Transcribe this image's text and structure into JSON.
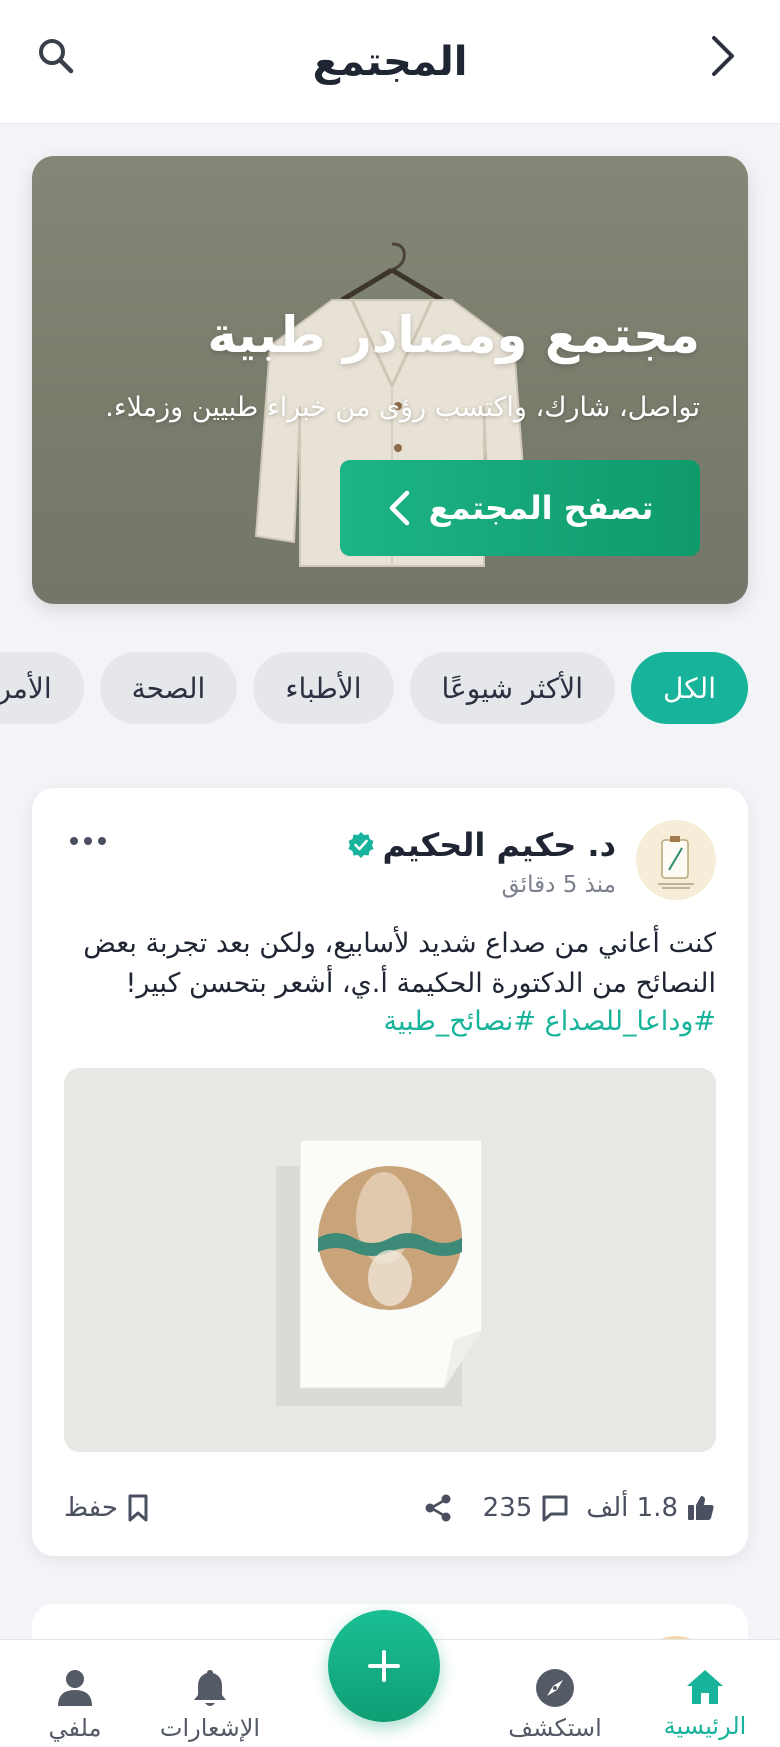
{
  "header": {
    "title": "المجتمع",
    "back_icon": "chevron-back-icon",
    "search_icon": "search-icon"
  },
  "hero": {
    "title": "مجتمع ومصادر طبية",
    "subtitle": "تواصل، شارك، واكتسب رؤى من خبراء طبيين وزملاء.",
    "cta_label": "تصفح المجتمع"
  },
  "filters": {
    "chips": [
      {
        "label": "الكل",
        "active": true
      },
      {
        "label": "الأكثر شيوعًا",
        "active": false
      },
      {
        "label": "الأطباء",
        "active": false
      },
      {
        "label": "الصحة",
        "active": false
      },
      {
        "label": "الأمراض",
        "active": false
      }
    ]
  },
  "post": {
    "author": "د. حكيم الحكيم",
    "verified": true,
    "time": "منذ 5 دقائق",
    "body": "كنت أعاني من صداع شديد لأسابيع، ولكن بعد تجربة بعض النصائح من الدكتورة الحكيمة أ.ي، أشعر بتحسن كبير!",
    "hashtags": "#وداعا_للصداع #نصائح_طبية",
    "likes": "1.8 ألف",
    "comments": "235",
    "save_label": "حفظ"
  },
  "bottom_nav": {
    "items": [
      {
        "label": "الرئيسية",
        "icon": "home-icon",
        "active": true
      },
      {
        "label": "استكشف",
        "icon": "compass-icon",
        "active": false
      },
      {
        "label": "الإشعارات",
        "icon": "bell-icon",
        "active": false
      },
      {
        "label": "ملفي",
        "icon": "user-icon",
        "active": false
      }
    ],
    "fab_icon": "plus-icon"
  },
  "colors": {
    "accent": "#17b39a",
    "cta": "#129f72"
  }
}
